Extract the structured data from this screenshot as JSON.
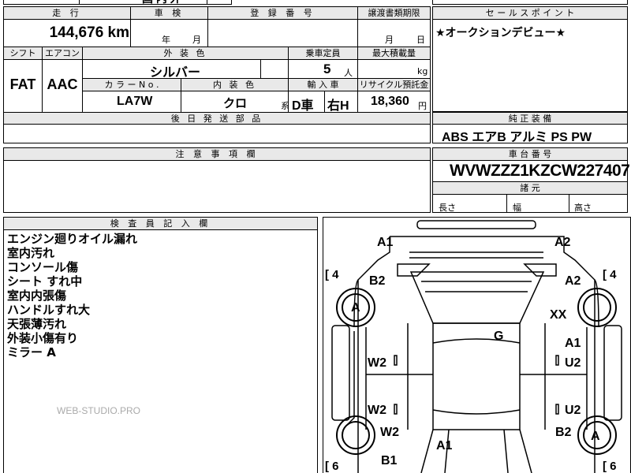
{
  "top_fragment": {
    "text": "国 内 外"
  },
  "summary": {
    "mileage_header": "走 行",
    "mileage_value": "144,676 km",
    "inspection_header": "車 検",
    "inspection_year": "年",
    "inspection_month": "月",
    "registration_header": "登 録 番 号",
    "transfer_header": "譲渡書類期限",
    "transfer_month": "月",
    "transfer_day": "日"
  },
  "specs": {
    "shift_header": "シフト",
    "shift_value": "FAT",
    "aircon_header": "エアコン",
    "aircon_value": "AAC",
    "exterior_color_header": "外 装 色",
    "exterior_color_value": "シルバー",
    "capacity_header": "乗車定員",
    "capacity_value": "5",
    "capacity_unit": "人",
    "max_load_header": "最大積載量",
    "max_load_unit": "kg",
    "color_no_header": "カ ラ ー N o .",
    "color_no_value": "LA7W",
    "interior_color_header": "内 装 色",
    "interior_color_value": "クロ",
    "interior_color_suffix": "系",
    "import_header": "輸 入 車",
    "import_value_1": "D車",
    "import_value_2": "右H",
    "recycle_header": "リサイクル預託金",
    "recycle_value": "18,360",
    "recycle_unit": "円",
    "shipping_header": "後 日 発 送 部 品"
  },
  "sales": {
    "header": "セ ー ル ス ポ イ ン ト",
    "text": "★オークションデビュー★"
  },
  "equipment": {
    "header": "純 正 装 備",
    "text": "ABS エアB アルミ PS PW"
  },
  "notes": {
    "header": "注 意 事 項 欄"
  },
  "chassis": {
    "header": "車 台 番 号",
    "value": "WVWZZZ1KZCW227407",
    "dims_header": "諸 元",
    "length": "長さ",
    "width": "幅",
    "height": "高さ"
  },
  "inspector": {
    "header": "検 査 員 記 入 欄",
    "lines": [
      "エンジン廻りオイル漏れ",
      "室内汚れ",
      "コンソール傷",
      "シート すれ中",
      "室内内張傷",
      "ハンドルすれ大",
      "天張薄汚れ",
      "外装小傷有り",
      "ミラー A"
    ],
    "watermark": "WEB-STUDIO.PRO"
  },
  "diagram": {
    "labels": {
      "front_left": "A1",
      "front_right": "A2",
      "bracket_tl": "4",
      "bracket_tr": "4",
      "left_fender": "B2",
      "left_tire": "A",
      "right_fender": "A2",
      "right_mark": "XX",
      "roof": "G",
      "left_door_front": "W2",
      "right_door_front_1": "A1",
      "right_door_front_2": "U2",
      "left_door_rear": "W2",
      "right_door_rear": "U2",
      "left_rear_wheel": "W2",
      "right_rear_fender": "B2",
      "right_rear_tire": "A",
      "rear_left": "B1",
      "trunk": "A1",
      "bracket_bl": "6",
      "bracket_br": "6"
    }
  }
}
